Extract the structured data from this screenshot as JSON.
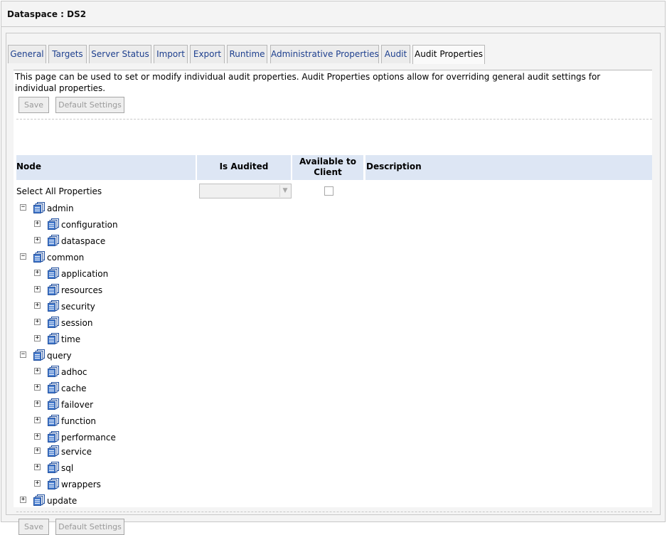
{
  "window": {
    "title": "Dataspace : DS2"
  },
  "tabs": [
    {
      "label": "General",
      "active": false
    },
    {
      "label": "Targets",
      "active": false
    },
    {
      "label": "Server Status",
      "active": false
    },
    {
      "label": "Import",
      "active": false
    },
    {
      "label": "Export",
      "active": false
    },
    {
      "label": "Runtime",
      "active": false
    },
    {
      "label": "Administrative Properties",
      "active": false
    },
    {
      "label": "Audit",
      "active": false
    },
    {
      "label": "Audit Properties",
      "active": true
    }
  ],
  "page": {
    "description": "This page can be used to set or modify individual audit properties. Audit Properties options allow for overriding general audit settings for individual properties.",
    "save_label": "Save",
    "default_settings_label": "Default Settings"
  },
  "table": {
    "col_node": "Node",
    "col_is_audited": "Is Audited",
    "col_available": "Available to Client",
    "col_description": "Description",
    "select_all_label": "Select All Properties",
    "select_all_value": "",
    "available_checked": false
  },
  "tree": [
    {
      "label": "admin",
      "level": 0,
      "expanded": true
    },
    {
      "label": "configuration",
      "level": 1,
      "expanded": false
    },
    {
      "label": "dataspace",
      "level": 1,
      "expanded": false
    },
    {
      "label": "common",
      "level": 0,
      "expanded": true
    },
    {
      "label": "application",
      "level": 1,
      "expanded": false
    },
    {
      "label": "resources",
      "level": 1,
      "expanded": false
    },
    {
      "label": "security",
      "level": 1,
      "expanded": false
    },
    {
      "label": "session",
      "level": 1,
      "expanded": false
    },
    {
      "label": "time",
      "level": 1,
      "expanded": false
    },
    {
      "label": "query",
      "level": 0,
      "expanded": true
    },
    {
      "label": "adhoc",
      "level": 1,
      "expanded": false
    },
    {
      "label": "cache",
      "level": 1,
      "expanded": false
    },
    {
      "label": "failover",
      "level": 1,
      "expanded": false
    },
    {
      "label": "function",
      "level": 1,
      "expanded": false
    },
    {
      "label": "performance",
      "level": 1,
      "expanded": false
    },
    {
      "label": "service",
      "level": 1,
      "expanded": false
    },
    {
      "label": "sql",
      "level": 1,
      "expanded": false
    },
    {
      "label": "wrappers",
      "level": 1,
      "expanded": false
    },
    {
      "label": "update",
      "level": 0,
      "expanded": false
    }
  ],
  "icons": {
    "tree_node": "database-folder-icon",
    "expand": "plus-box-icon",
    "collapse": "minus-box-icon",
    "dropdown": "chevron-down-icon"
  },
  "colors": {
    "tab_link": "#1d3f8e",
    "header_bg": "#dde6f4",
    "panel_bg": "#f4f4f4"
  }
}
